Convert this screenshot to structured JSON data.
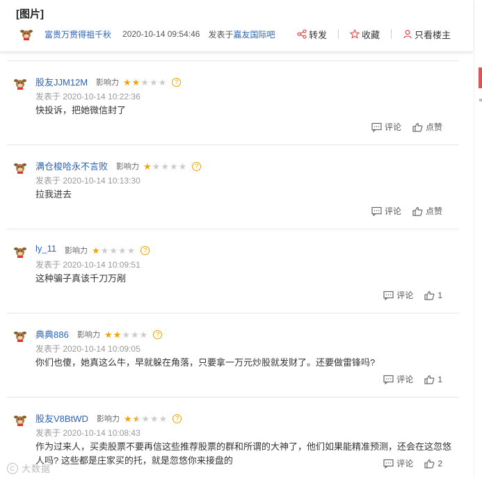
{
  "post": {
    "title": "[图片]",
    "author": "富贵万贯得祖千秋",
    "date": "2020-10-14 09:54:46",
    "posted_prefix": "发表于",
    "posted_source": "嘉友国际吧",
    "actions": {
      "forward": "转发",
      "favorite": "收藏",
      "owner_only": "只看楼主"
    }
  },
  "colors": {
    "link": "#2a63b8",
    "star": "#f5a200",
    "accent": "#e15353"
  },
  "influence_label": "影响力",
  "comment_label": "评论",
  "like_label": "点赞",
  "replies": [
    {
      "user": "股友JJM12M",
      "stars": 2,
      "time": "发表于 2020-10-14 10:22:36",
      "text": "快投诉，把她微信封了",
      "likes": "点赞"
    },
    {
      "user": "满仓梭哈永不言败",
      "stars": 1,
      "time": "发表于 2020-10-14 10:13:30",
      "text": "拉我进去",
      "likes": "点赞"
    },
    {
      "user": "ly_11",
      "stars": 1,
      "time": "发表于 2020-10-14 10:09:51",
      "text": "这种骗子真该千刀万剐",
      "likes": "1"
    },
    {
      "user": "典典886",
      "stars": 2,
      "time": "发表于 2020-10-14 10:09:05",
      "text": "你们也傻，她真这么牛，早就躲在角落，只要拿一万元炒股就发财了。还要做雷锋吗?",
      "likes": "1"
    },
    {
      "user": "股友V8BtWD",
      "stars": 1.5,
      "time": "发表于 2020-10-14 10:08:43",
      "text": "作为过来人，买卖股票不要再信这些推荐股票的群和所谓的大神了，他们如果能精准预测，还会在这忽悠人吗? 这些都是庄家买的托，就是忽悠你来接盘的",
      "likes": "2"
    }
  ],
  "watermark": "大数据"
}
